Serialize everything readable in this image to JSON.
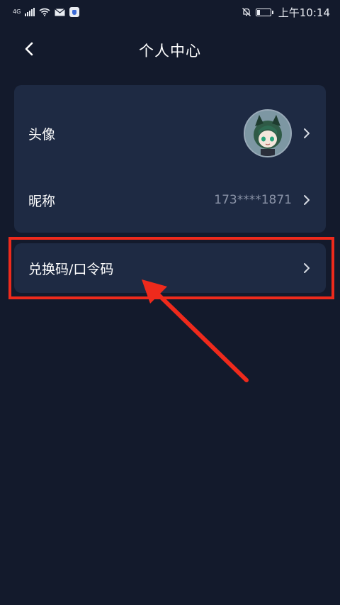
{
  "status_bar": {
    "network": "4G",
    "time": "上午10:14",
    "battery_level": 0.2
  },
  "header": {
    "title": "个人中心",
    "back_icon": "chevron-left-icon"
  },
  "profile": {
    "avatar_label": "头像",
    "nickname_label": "昵称",
    "nickname_value": "173****1871"
  },
  "redeem": {
    "label": "兑换码/口令码"
  },
  "colors": {
    "background": "#131a2c",
    "card": "#1e2a43",
    "highlight": "#ee2a1c",
    "muted_text": "#8a93a7"
  }
}
